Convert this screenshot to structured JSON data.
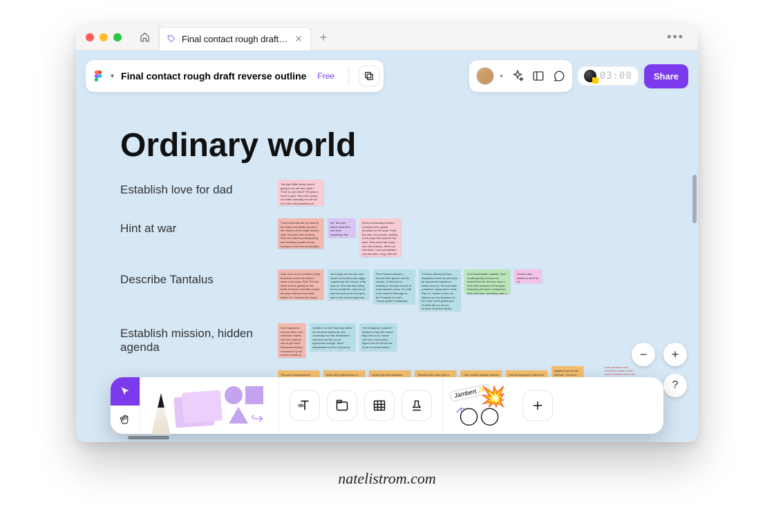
{
  "tab": {
    "title": "Final contact rough draft reverse"
  },
  "doc": {
    "title": "Final contact rough draft reverse outline",
    "plan": "Free"
  },
  "timer": "03:00",
  "share_label": "Share",
  "page": {
    "heading": "Ordinary world",
    "rows": [
      {
        "label": "Establish love for dad"
      },
      {
        "label": "Hint at war"
      },
      {
        "label": "Describe Tantalus"
      },
      {
        "label": "Establish mission, hidden agenda"
      },
      {
        "label": ""
      }
    ]
  },
  "toolbar": {
    "jambert": "Jambert ✨"
  },
  "caption": "natelistrom.com"
}
